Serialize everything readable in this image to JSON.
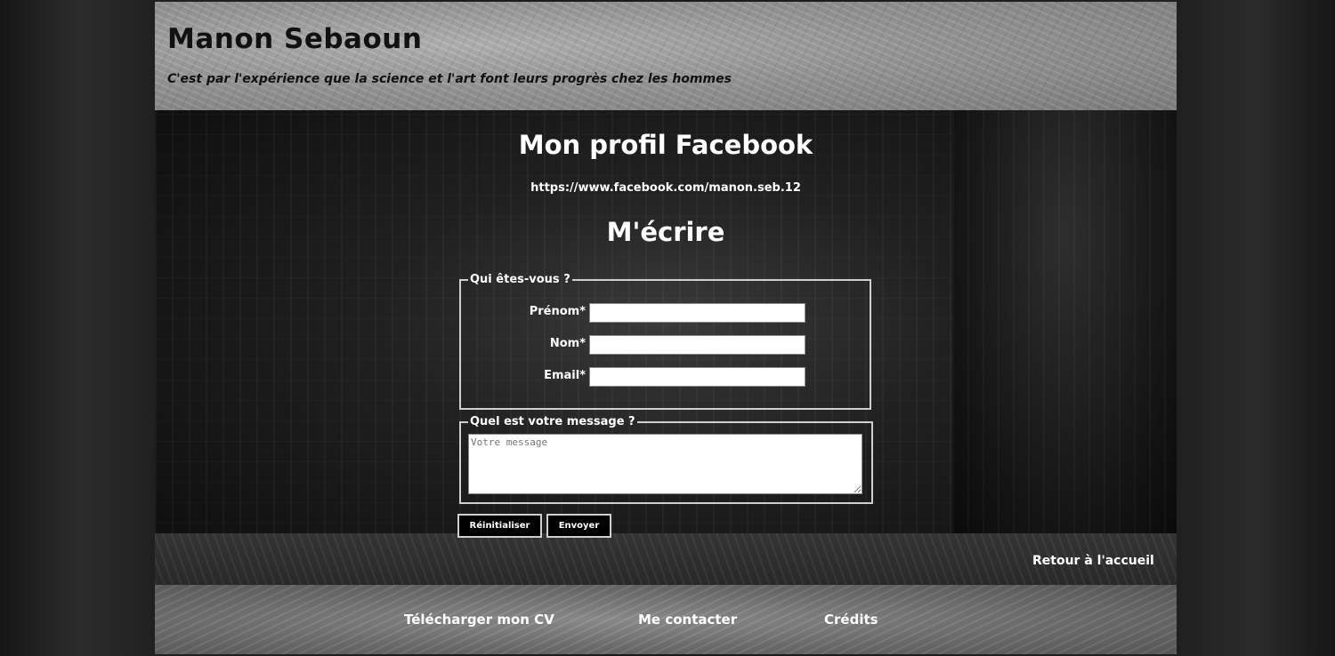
{
  "header": {
    "title": "Manon Sebaoun",
    "tagline": "C'est par l'expérience que la science et l'art font leurs progrès chez les hommes"
  },
  "main": {
    "facebook_heading": "Mon profil Facebook",
    "facebook_url": "https://www.facebook.com/manon.seb.12",
    "contact_heading": "M'écrire",
    "identity_legend": "Qui êtes-vous ?",
    "fields": [
      {
        "label": "Prénom*",
        "value": ""
      },
      {
        "label": "Nom*",
        "value": ""
      },
      {
        "label": "Email*",
        "value": ""
      }
    ],
    "message_legend": "Quel est votre message ?",
    "message_placeholder": "Votre message",
    "reset_label": "Réinitialiser",
    "send_label": "Envoyer",
    "back_home": "Retour à l'accueil"
  },
  "footer": {
    "links": [
      "Télécharger mon CV",
      "Me contacter",
      "Crédits"
    ]
  }
}
